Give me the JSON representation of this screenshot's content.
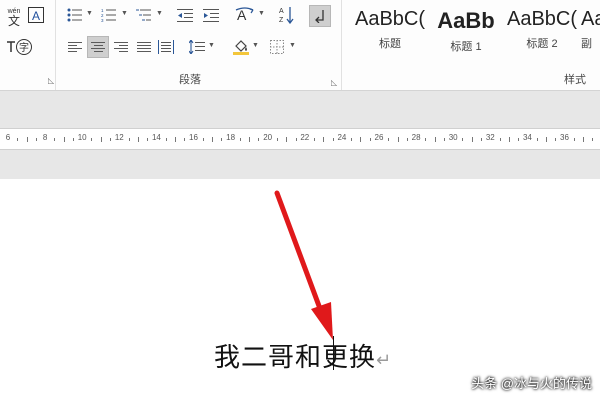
{
  "ribbon": {
    "paragraph_group_label": "段落",
    "styles_group_label": "样式",
    "font_tail": {
      "phonetic_label": "wén\n文",
      "border_char_label": "A",
      "enclose_char_label": "字"
    },
    "styles": [
      {
        "sample": "AaBbC(",
        "name": "标题"
      },
      {
        "sample": "AaBb",
        "name": "标题 1"
      },
      {
        "sample": "AaBbC(",
        "name": "标题 2"
      },
      {
        "sample": "Aa",
        "name": "副"
      }
    ]
  },
  "ruler": {
    "labels": [
      "6",
      "8",
      "10",
      "12",
      "14",
      "16",
      "18",
      "20",
      "22",
      "24",
      "26",
      "28",
      "30",
      "32",
      "34",
      "36"
    ]
  },
  "document": {
    "text": "我二哥和更换",
    "paragraph_mark": "↵"
  },
  "watermark": "头条 @冰与火的传说",
  "colors": {
    "accent_arrow": "#e0191b",
    "ribbon_bg": "#fdfdfd",
    "band_bg": "#e7e7e7"
  }
}
